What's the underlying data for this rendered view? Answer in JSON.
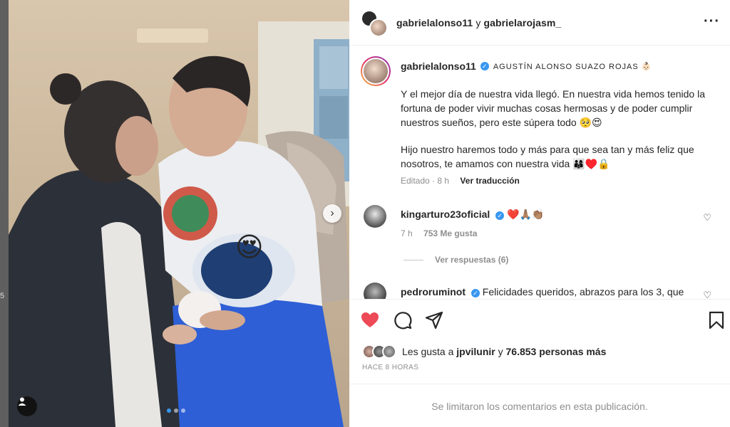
{
  "colors": {
    "accent": "#3897f0",
    "like_red": "#ed4956",
    "muted": "#8e8e8e",
    "text": "#262626"
  },
  "backdrop": {
    "edge_mark": "5"
  },
  "header": {
    "author": "gabrielalonso11",
    "conjunction": "y",
    "coauthor": "gabrielarojasm_",
    "more_icon": "more-horizontal-icon"
  },
  "caption": {
    "username": "gabrielalonso11",
    "subtitle": "AGUSTÍN ALONSO SUAZO ROJAS 👶🏻",
    "paragraph1": "Y el mejor día de nuestra vida llegó. En nuestra vida hemos tenido la fortuna de poder vivir muchas cosas hermosas y de poder cumplir nuestros sueños, pero este súpera todo 🥺😍",
    "paragraph2": "Hijo nuestro haremos todo y más para que sea tan y más feliz que nosotros, te amamos con nuestra vida 👨‍👩‍👦♥️🔒",
    "status": "Editado",
    "time": "8 h",
    "translate": "Ver traducción"
  },
  "comments": [
    {
      "username": "kingarturo23oficial",
      "text": "❤️🙏🏽👏🏽",
      "time": "7 h",
      "likes": "753 Me gusta",
      "replies": "Ver respuestas (6)"
    },
    {
      "username": "pedroruminot",
      "text": "Felicidades queridos, abrazos para los 3, que"
    }
  ],
  "actions": {
    "like_icon": "heart-filled-icon",
    "comment_icon": "comment-icon",
    "share_icon": "share-icon",
    "save_icon": "bookmark-icon"
  },
  "likes": {
    "prefix": "Les gusta a",
    "user": "jpvilunir",
    "conj": "y",
    "count": "76.853 personas más"
  },
  "time_ago": "HACE 8 HORAS",
  "comments_off": "Se limitaron los comentarios en esta publicación.",
  "carousel": {
    "total": 3,
    "active": 1
  },
  "sticker_emoji": "😍"
}
